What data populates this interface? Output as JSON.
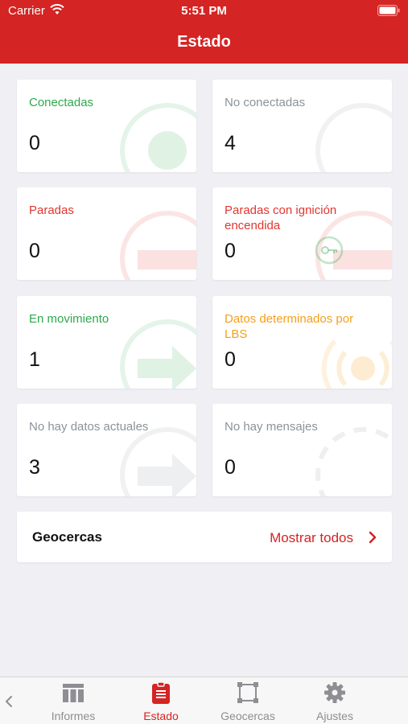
{
  "status_bar": {
    "carrier": "Carrier",
    "time": "5:51 PM"
  },
  "header": {
    "title": "Estado"
  },
  "cards": [
    {
      "label": "Conectadas",
      "count": "0",
      "color": "#2ea94a"
    },
    {
      "label": "No conectadas",
      "count": "4",
      "color": "#8a9499"
    },
    {
      "label": "Paradas",
      "count": "0",
      "color": "#e3352f"
    },
    {
      "label": "Paradas con ignición encendida",
      "count": "0",
      "color": "#e3352f"
    },
    {
      "label": "En movimiento",
      "count": "1",
      "color": "#2ea94a"
    },
    {
      "label": "Datos determinados por LBS",
      "count": "0",
      "color": "#f5a01a"
    },
    {
      "label": "No hay datos actuales",
      "count": "3",
      "color": "#8a9499"
    },
    {
      "label": "No hay mensajes",
      "count": "0",
      "color": "#8a9499"
    }
  ],
  "geofences": {
    "title": "Geocercas",
    "link": "Mostrar todos"
  },
  "tabbar": {
    "active_color": "#d42423",
    "items": [
      {
        "label": "Informes",
        "icon": "table-icon"
      },
      {
        "label": "Estado",
        "icon": "clipboard-icon",
        "active": true
      },
      {
        "label": "Geocercas",
        "icon": "polygon-icon"
      },
      {
        "label": "Ajustes",
        "icon": "gear-icon"
      }
    ]
  }
}
